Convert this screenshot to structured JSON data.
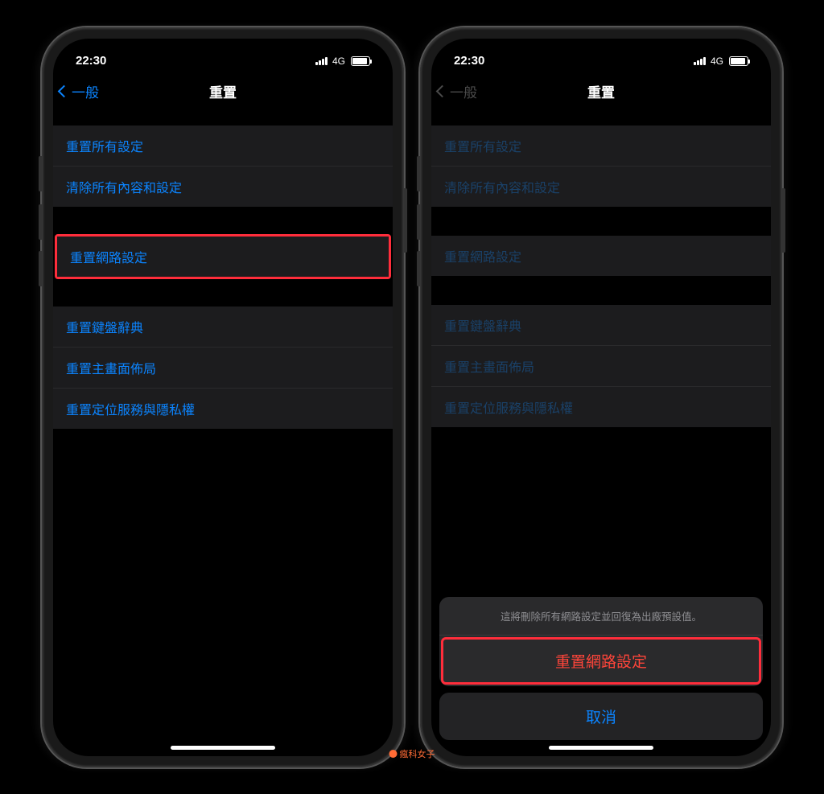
{
  "status": {
    "time": "22:30",
    "network": "4G"
  },
  "nav": {
    "back_label": "一般",
    "title": "重置"
  },
  "left": {
    "group1": {
      "item1": "重置所有設定",
      "item2": "清除所有內容和設定"
    },
    "group2": {
      "item1": "重置網路設定"
    },
    "group3": {
      "item1": "重置鍵盤辭典",
      "item2": "重置主畫面佈局",
      "item3": "重置定位服務與隱私權"
    }
  },
  "right": {
    "group1": {
      "item1": "重置所有設定",
      "item2": "清除所有內容和設定"
    },
    "group2": {
      "item1": "重置網路設定"
    },
    "group3": {
      "item1": "重置鍵盤辭典",
      "item2": "重置主畫面佈局",
      "item3": "重置定位服務與隱私權"
    },
    "sheet": {
      "message": "這將刪除所有網路設定並回復為出廠預設值。",
      "confirm": "重置網路設定",
      "cancel": "取消"
    }
  },
  "watermark": "瘋科女子"
}
